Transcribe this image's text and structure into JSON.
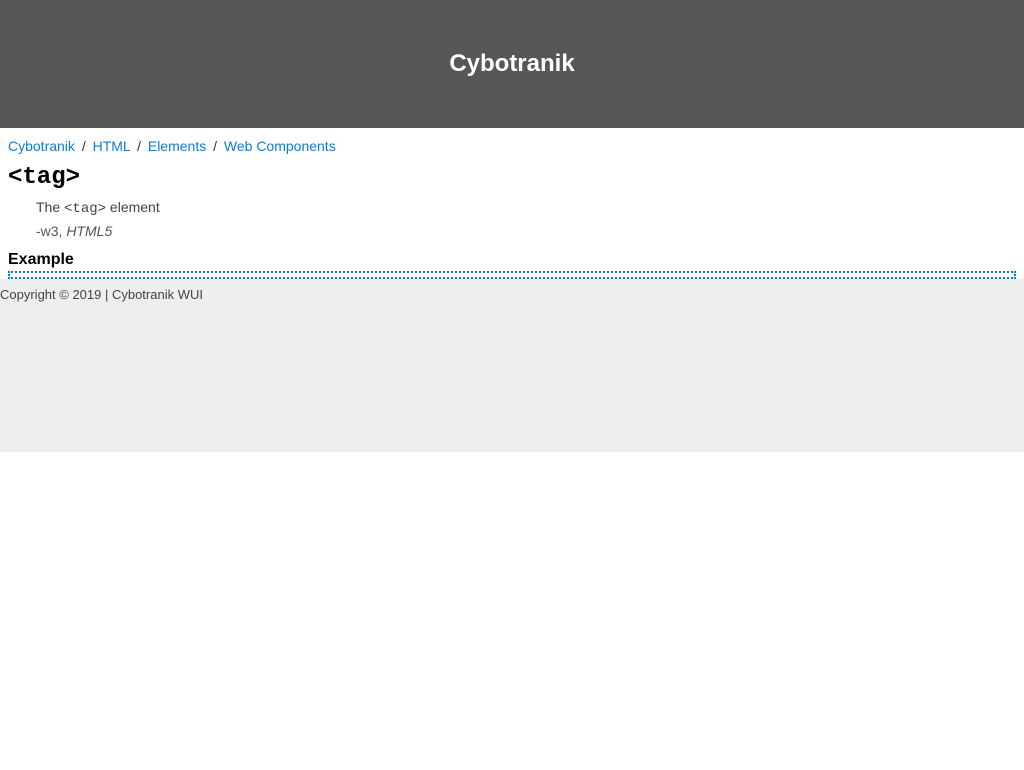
{
  "header": {
    "title": "Cybotranik"
  },
  "breadcrumb": {
    "items": [
      {
        "label": "Cybotranik"
      },
      {
        "label": "HTML"
      },
      {
        "label": "Elements"
      },
      {
        "label": "Web Components"
      }
    ],
    "separator": "/"
  },
  "content": {
    "tag_title": "<tag>",
    "description_prefix": "The ",
    "description_code": "<tag>",
    "description_suffix": " element",
    "citation_prefix": "-w3, ",
    "citation_source": "HTML5",
    "example_heading": "Example"
  },
  "footer": {
    "copyright": "Copyright © 2019 | Cybotranik WUI"
  }
}
